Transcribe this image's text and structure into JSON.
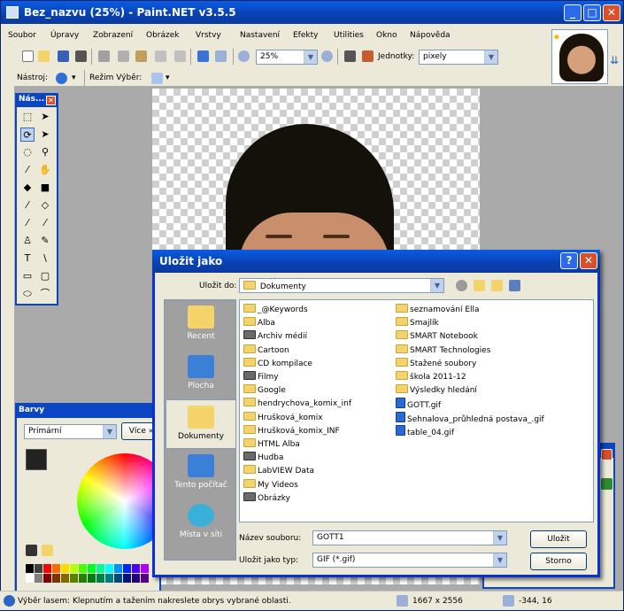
{
  "window": {
    "title": "Bez_nazvu (25%) - Paint.NET v3.5.5"
  },
  "menu": [
    "Soubor",
    "Úpravy",
    "Zobrazení",
    "Obrázek",
    "Vrstvy",
    "Nastavení",
    "Efekty",
    "Utilities",
    "Okno",
    "Nápověda"
  ],
  "toolbar": {
    "zoom": "25%",
    "units_label": "Jednotky:",
    "units_value": "pixely"
  },
  "toolbar2": {
    "tool_label": "Nástroj:",
    "mode_label": "Režim Výběr:"
  },
  "tools_palette": {
    "title": "Nás..."
  },
  "colors_palette": {
    "title": "Barvy",
    "primary": "Primární",
    "more_button": "Více »"
  },
  "dialog": {
    "title": "Uložit jako",
    "save_in_label": "Uložit do:",
    "save_in_value": "Dokumenty",
    "places": [
      "Recent",
      "Plocha",
      "Dokumenty",
      "Tento počítač",
      "Místa v síti"
    ],
    "files_col1": [
      {
        "name": "_@Keywords",
        "type": "folder"
      },
      {
        "name": "Alba",
        "type": "folder"
      },
      {
        "name": "Archiv médií",
        "type": "special"
      },
      {
        "name": "Cartoon",
        "type": "folder"
      },
      {
        "name": "CD kompilace",
        "type": "folder"
      },
      {
        "name": "Filmy",
        "type": "special"
      },
      {
        "name": "Google",
        "type": "folder"
      },
      {
        "name": "hendrychova_komix_inf",
        "type": "folder"
      },
      {
        "name": "Hrušková_komix",
        "type": "folder"
      },
      {
        "name": "Hrušková_komix_INF",
        "type": "folder"
      },
      {
        "name": "HTML Alba",
        "type": "folder"
      },
      {
        "name": "Hudba",
        "type": "special"
      },
      {
        "name": "LabVIEW Data",
        "type": "folder"
      },
      {
        "name": "My Videos",
        "type": "folder"
      },
      {
        "name": "Obrázky",
        "type": "special"
      }
    ],
    "files_col2": [
      {
        "name": "seznamování Ella",
        "type": "folder"
      },
      {
        "name": "Smajlík",
        "type": "folder"
      },
      {
        "name": "SMART Notebook",
        "type": "folder"
      },
      {
        "name": "SMART Technologies",
        "type": "folder"
      },
      {
        "name": "Stažené soubory",
        "type": "folder"
      },
      {
        "name": "škola 2011-12",
        "type": "folder"
      },
      {
        "name": "Výsledky hledání",
        "type": "folder"
      },
      {
        "name": "GOTT.gif",
        "type": "gif"
      },
      {
        "name": "Sehnalova_průhledná postava_.gif",
        "type": "gif"
      },
      {
        "name": "table_04.gif",
        "type": "gif"
      }
    ],
    "filename_label": "Název souboru:",
    "filename_value": "GOTT1",
    "filetype_label": "Uložit jako typ:",
    "filetype_value": "GIF (*.gif)",
    "save_button": "Uložit",
    "cancel_button": "Storno"
  },
  "status": {
    "hint": "Výběr lasem: Klepnutím a tažením nakreslete obrys vybrané oblasti.",
    "size": "1667 x 2556",
    "coords": "-344, 16"
  }
}
